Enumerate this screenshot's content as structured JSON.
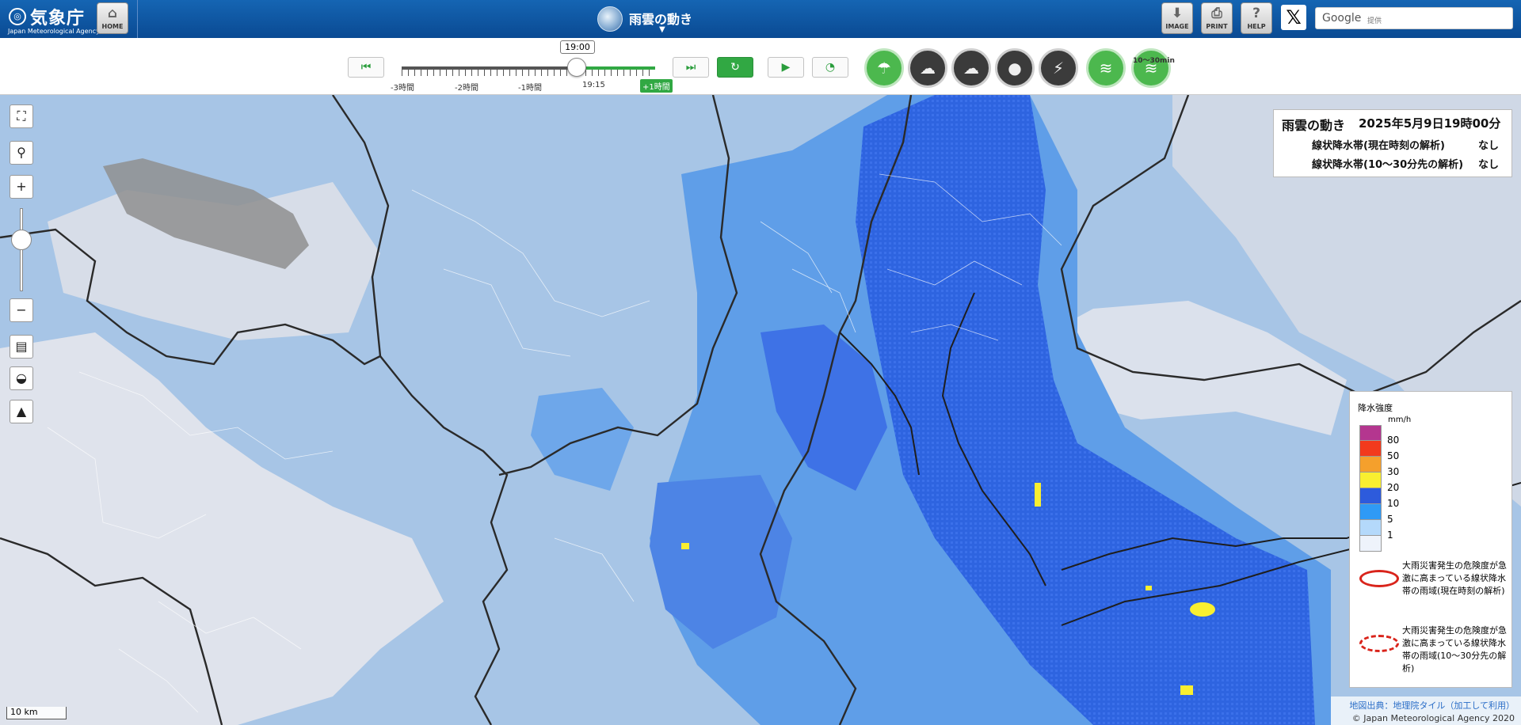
{
  "header": {
    "logo_jp": "気象庁",
    "logo_en": "Japan Meteorological Agency",
    "home_label": "HOME",
    "page_title": "雨雲の動き",
    "image_label": "IMAGE",
    "print_label": "PRINT",
    "help_label": "HELP",
    "x_label": "𝕏",
    "search_brand": "Google",
    "search_note": "提供"
  },
  "timeline": {
    "current": "19:00",
    "labels": [
      "-3時間",
      "-2時間",
      "-1時間",
      "19:15"
    ],
    "plus": "+1時間",
    "position_fraction": 0.75
  },
  "layers": {
    "tag": "10～30min",
    "items": [
      "rain-cloud-icon",
      "thunder-cloud-icon",
      "tornado-cloud-icon",
      "drop-icon",
      "lightning-icon",
      "linear-band-icon",
      "linear-band-forecast-icon"
    ]
  },
  "info": {
    "title": "雨雲の動き",
    "time": "2025年5月9日19時00分",
    "row1_label": "線状降水帯(現在時刻の解析)",
    "row1_value": "なし",
    "row2_label": "線状降水帯(10～30分先の解析)",
    "row2_value": "なし"
  },
  "legend": {
    "title": "降水強度",
    "unit": "mm/h",
    "levels": [
      {
        "label": "80",
        "color": "#b4368f"
      },
      {
        "label": "50",
        "color": "#f23a1d"
      },
      {
        "label": "30",
        "color": "#f5a02c"
      },
      {
        "label": "20",
        "color": "#f9ef30"
      },
      {
        "label": "10",
        "color": "#2d5bdc"
      },
      {
        "label": "5",
        "color": "#2f9af5"
      },
      {
        "label": "1",
        "color": "#b4d9fb"
      },
      {
        "label": "",
        "color": "#eef3fb"
      }
    ],
    "note1": "大雨災害発生の危険度が急激に高まっている線状降水帯の雨域(現在時刻の解析)",
    "note2": "大雨災害発生の危険度が急激に高まっている線状降水帯の雨域(10～30分先の解析)"
  },
  "map": {
    "scale": "10 km",
    "attribution1": "地図出典：地理院タイル（加工して利用）",
    "attribution2": "© Japan Meteorological Agency 2020"
  }
}
